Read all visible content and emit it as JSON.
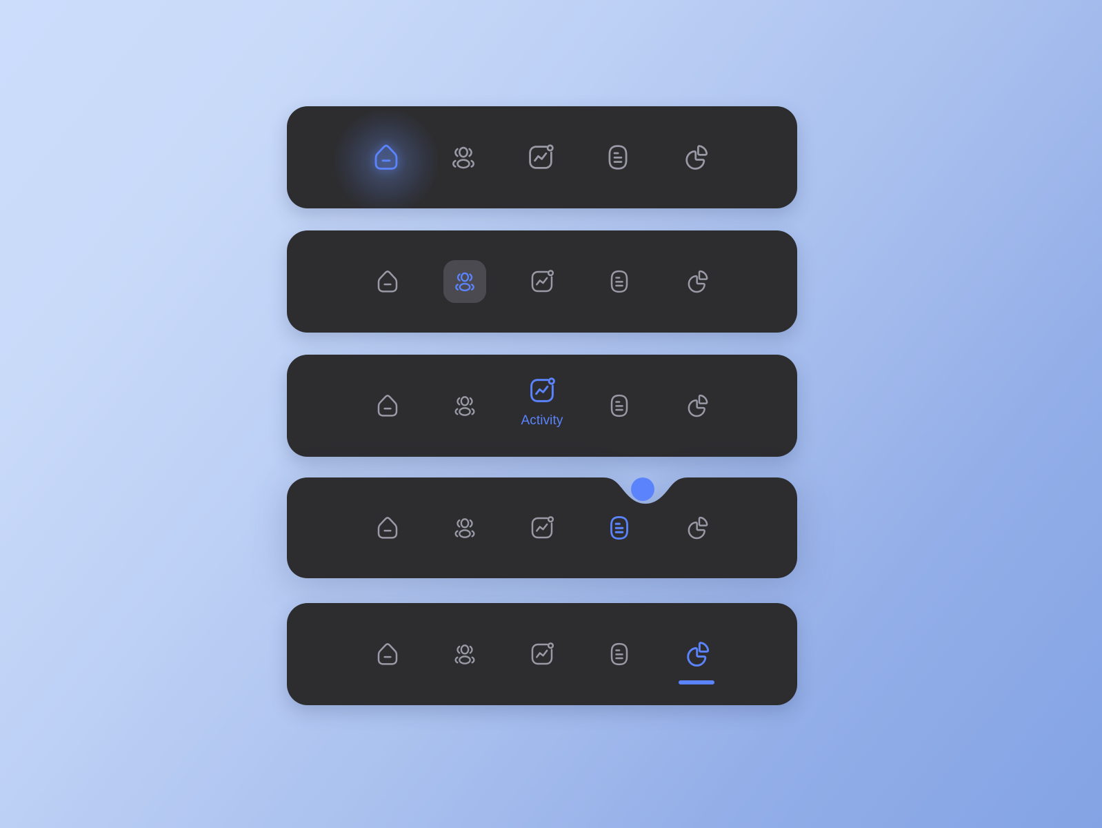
{
  "theme": {
    "background_gradient_from": "#ccddfc",
    "background_gradient_to": "#83a3e4",
    "bar_background": "#2d2d30",
    "accent": "#5b84fc",
    "icon_idle": "#9a9aa6",
    "pill_background": "#4a4a50"
  },
  "nav_items": [
    {
      "id": "home",
      "icon": "home-icon",
      "label": "Home"
    },
    {
      "id": "users",
      "icon": "users-icon",
      "label": "Users"
    },
    {
      "id": "activity",
      "icon": "activity-icon",
      "label": "Activity"
    },
    {
      "id": "docs",
      "icon": "document-icon",
      "label": "Docs"
    },
    {
      "id": "reports",
      "icon": "pie-chart-icon",
      "label": "Reports"
    }
  ],
  "bars": [
    {
      "variant": "glow",
      "active_index": 0,
      "active_label": "Home",
      "show_label": false
    },
    {
      "variant": "pill",
      "active_index": 1,
      "active_label": "Users",
      "show_label": false
    },
    {
      "variant": "label",
      "active_index": 2,
      "active_label": "Activity",
      "show_label": true
    },
    {
      "variant": "notch",
      "active_index": 3,
      "active_label": "Docs",
      "show_label": false
    },
    {
      "variant": "underline",
      "active_index": 4,
      "active_label": "Reports",
      "show_label": false
    }
  ]
}
